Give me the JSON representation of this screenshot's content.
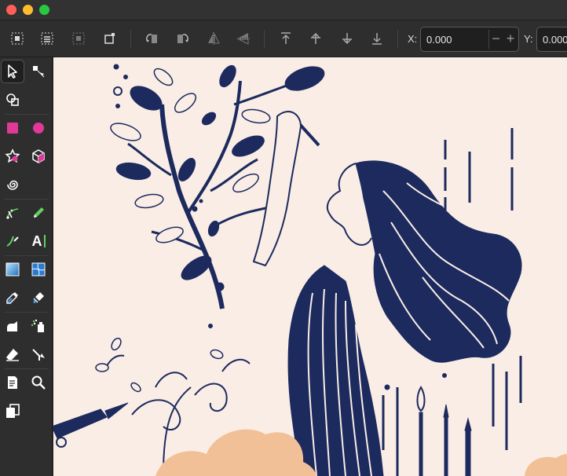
{
  "window": {
    "traffic_lights": [
      "close",
      "minimize",
      "zoom"
    ]
  },
  "controls": {
    "x_label": "X:",
    "x_value": "0.000",
    "y_label": "Y:",
    "y_value": "0.000",
    "minus_symbol": "−",
    "plus_symbol": "+",
    "buttons": [
      "select-all-icon",
      "select-all-layers-icon",
      "deselect-icon",
      "bounding-box-icon",
      "rotate-ccw-icon",
      "rotate-cw-icon",
      "flip-horizontal-icon",
      "flip-vertical-icon",
      "raise-to-top-icon",
      "raise-icon",
      "lower-icon",
      "lower-to-bottom-icon"
    ]
  },
  "toolbox": {
    "tools": [
      "selector-icon",
      "node-icon",
      "shape-builder-icon",
      "rectangle-icon",
      "circle-icon",
      "star-icon",
      "box-3d-icon",
      "spiral-icon",
      "pen-icon",
      "pencil-icon",
      "calligraphy-icon",
      "text-icon",
      "gradient-icon",
      "mesh-icon",
      "dropper-icon",
      "paint-bucket-icon",
      "tweak-icon",
      "spray-icon",
      "eraser-icon",
      "connector-icon",
      "pages-icon",
      "zoom-icon",
      "clone-icon"
    ],
    "text_tool_glyph": "A"
  },
  "colors": {
    "canvas_background": "#faede6",
    "artwork_navy": "#1c2a5e",
    "cloud_peach": "#f2c097",
    "rectangle_tool": "#e0399a",
    "circle_tool": "#e0399a",
    "active_tool_bg": "#1f1f1f"
  }
}
